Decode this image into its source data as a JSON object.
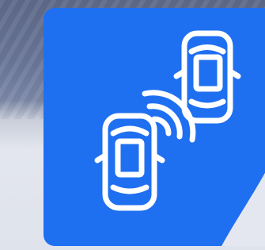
{
  "icon": {
    "name": "blind-spot-detection-icon",
    "card_color": "#1f6ff1",
    "card_color_dark": "#1a63db",
    "glyph_color": "#ffffff",
    "background_color": "#e4e7ef"
  }
}
